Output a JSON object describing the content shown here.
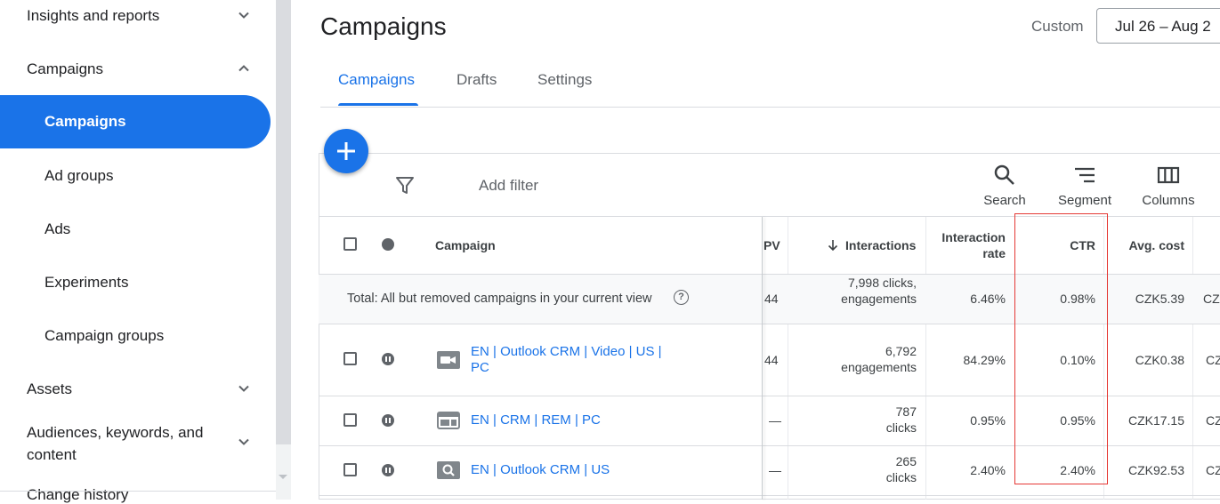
{
  "sidebar": {
    "sections": [
      {
        "label": "Insights and reports",
        "expanded": false
      },
      {
        "label": "Campaigns",
        "expanded": true
      },
      {
        "label": "Assets",
        "expanded": false
      },
      {
        "label": "Audiences, keywords, and content",
        "expanded": false
      },
      {
        "label": "Change history"
      }
    ],
    "subitems": [
      "Campaigns",
      "Ad groups",
      "Ads",
      "Experiments",
      "Campaign groups"
    ],
    "active_subitem": "Campaigns"
  },
  "header": {
    "title": "Campaigns",
    "date_mode": "Custom",
    "date_range": "Jul 26 – Aug 2"
  },
  "tabs": [
    "Campaigns",
    "Drafts",
    "Settings"
  ],
  "active_tab": "Campaigns",
  "toolbar": {
    "add_filter": "Add filter",
    "search": "Search",
    "segment": "Segment",
    "columns": "Columns"
  },
  "table": {
    "headers": {
      "campaign": "Campaign",
      "pv": "PV",
      "interactions": "Interactions",
      "interaction_rate": "Interaction rate",
      "ctr": "CTR",
      "avg_cost": "Avg. cost"
    },
    "total": {
      "label": "Total: All but removed campaigns in your current view",
      "pv": "44",
      "interactions": "7,998 clicks, engagements",
      "interaction_rate": "6.46%",
      "ctr": "0.98%",
      "avg_cost": "CZK5.39",
      "next": "CZ"
    },
    "rows": [
      {
        "name": "EN | Outlook CRM | Video | US | PC",
        "type_icon": "video-campaign-icon",
        "pv": "44",
        "interactions": "6,792",
        "interaction_unit": "engagements",
        "interaction_rate": "84.29%",
        "ctr": "0.10%",
        "avg_cost": "CZK0.38",
        "next": "CZ"
      },
      {
        "name": "EN | CRM | REM | PC",
        "type_icon": "display-campaign-icon",
        "pv": "—",
        "interactions": "787",
        "interaction_unit": "clicks",
        "interaction_rate": "0.95%",
        "ctr": "0.95%",
        "avg_cost": "CZK17.15",
        "next": "CZ"
      },
      {
        "name": "EN | Outlook CRM | US",
        "type_icon": "search-campaign-icon",
        "pv": "—",
        "interactions": "265",
        "interaction_unit": "clicks",
        "interaction_rate": "2.40%",
        "ctr": "2.40%",
        "avg_cost": "CZK92.53",
        "next": "CZ"
      }
    ]
  },
  "colors": {
    "accent": "#1a73e8",
    "highlight": "#e53935"
  }
}
